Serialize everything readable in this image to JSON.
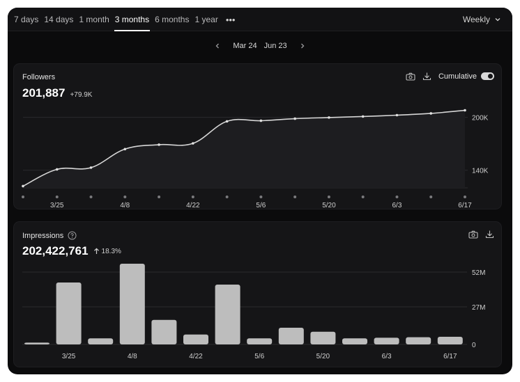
{
  "range_tabs": [
    "7 days",
    "14 days",
    "1 month",
    "3 months",
    "6 months",
    "1 year"
  ],
  "active_range": "3 months",
  "granularity": "Weekly",
  "date_range": {
    "start": "Mar 24",
    "end": "Jun 23"
  },
  "followers": {
    "title": "Followers",
    "value": "201,887",
    "delta": "+79.9K",
    "toggle_label": "Cumulative",
    "toggle_on": true
  },
  "impressions": {
    "title": "Impressions",
    "value": "202,422,761",
    "delta": "18.3%"
  },
  "icons": [
    "more-icon",
    "chevron-down-icon",
    "chevron-left-icon",
    "chevron-right-icon",
    "camera-icon",
    "download-icon",
    "help-icon",
    "arrow-up-icon"
  ],
  "chart_data": [
    {
      "type": "line",
      "title": "Followers",
      "x_tick_labels": [
        "3/25",
        "4/8",
        "4/22",
        "5/6",
        "5/20",
        "6/3",
        "6/17"
      ],
      "x": [
        "3/18",
        "3/25",
        "4/1",
        "4/8",
        "4/15",
        "4/22",
        "4/29",
        "5/6",
        "5/13",
        "5/20",
        "5/27",
        "6/3",
        "6/10",
        "6/17"
      ],
      "series": [
        {
          "values": [
            122000,
            141000,
            143000,
            164000,
            169000,
            170500,
            195500,
            196200,
            198500,
            199800,
            201000,
            202500,
            204500,
            208000
          ]
        }
      ],
      "y_tick_labels": [
        "140K",
        "200K"
      ],
      "ylim": [
        120000,
        210000
      ],
      "grid": true
    },
    {
      "type": "bar",
      "title": "Impressions",
      "x_tick_labels": [
        "3/25",
        "4/8",
        "4/22",
        "5/6",
        "5/20",
        "6/3",
        "6/17"
      ],
      "categories": [
        "3/18",
        "3/25",
        "4/1",
        "4/8",
        "4/15",
        "4/22",
        "4/29",
        "5/6",
        "5/13",
        "5/20",
        "5/27",
        "6/3",
        "6/10",
        "6/17"
      ],
      "values": [
        1300000,
        44500000,
        4400000,
        58000000,
        17600000,
        7100000,
        43000000,
        4400000,
        12000000,
        9100000,
        4400000,
        4800000,
        5200000,
        5500000
      ],
      "y_tick_labels": [
        "0",
        "27M",
        "52M"
      ],
      "ylim": [
        0,
        57000000
      ],
      "grid": true
    }
  ],
  "colors": {
    "background": "#0b0b0c",
    "card": "#151517",
    "line": "#d6d6d6",
    "bar": "#bdbdbd",
    "text": "#e8e8e8"
  }
}
